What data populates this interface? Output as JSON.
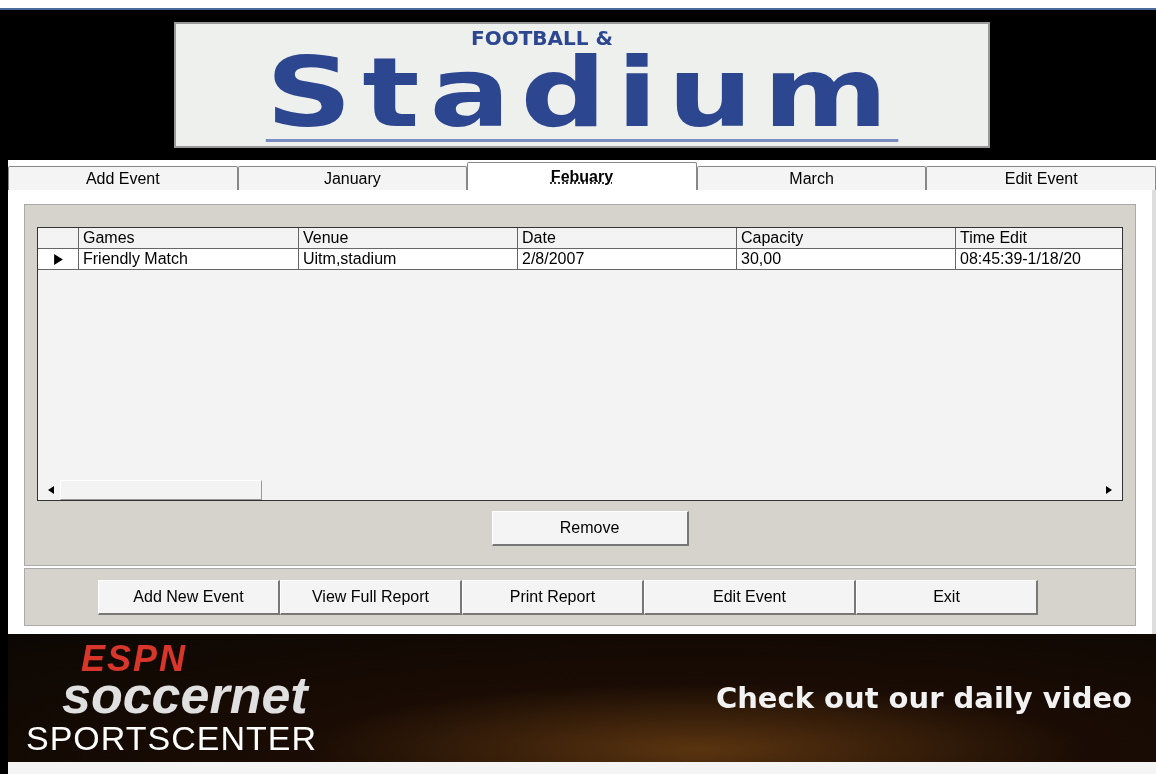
{
  "logo": {
    "kicker": "FOOTBALL &",
    "title": "Stadium"
  },
  "tabs": [
    {
      "label": "Add Event",
      "selected": false
    },
    {
      "label": "January",
      "selected": false
    },
    {
      "label": "Febuary",
      "selected": true
    },
    {
      "label": "March",
      "selected": false
    },
    {
      "label": "Edit Event",
      "selected": false
    }
  ],
  "table": {
    "columns": [
      "Games",
      "Venue",
      "Date",
      "Capacity",
      "Time Edit"
    ],
    "rows": [
      {
        "selected": true,
        "cells": [
          "Friendly Match",
          "Uitm,stadium",
          "2/8/2007",
          "30,00",
          "08:45:39-1/18/20"
        ]
      }
    ]
  },
  "remove_button": "Remove",
  "buttons": [
    "Add New Event",
    "View Full Report",
    "Print Report",
    "Edit Event",
    "Exit"
  ],
  "banner": {
    "brand": "ESPN",
    "product": "soccernet",
    "show": "SPORTSCENTER",
    "tagline": "Check out our daily video"
  }
}
